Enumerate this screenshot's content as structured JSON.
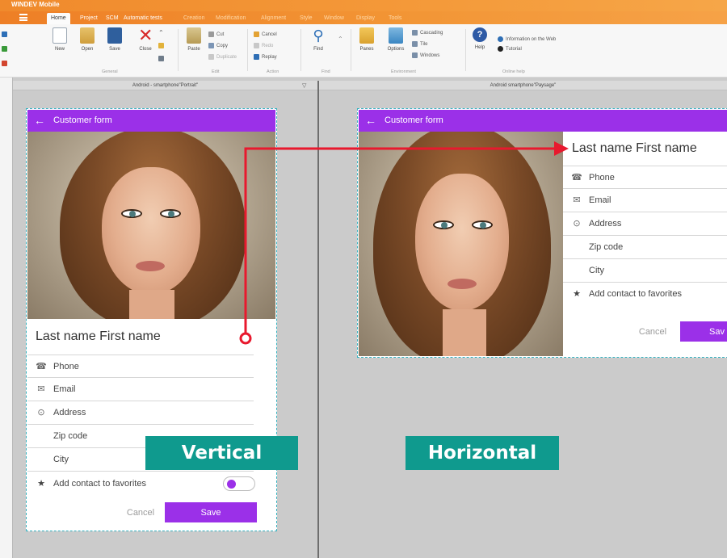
{
  "app": {
    "title": "WINDEV Mobile"
  },
  "menu_tabs": [
    {
      "label": "Home"
    },
    {
      "label": "Project"
    },
    {
      "label": "SCM"
    },
    {
      "label": "Automatic tests"
    },
    {
      "label": "Creation"
    },
    {
      "label": "Modification"
    },
    {
      "label": "Alignment"
    },
    {
      "label": "Style"
    },
    {
      "label": "Window"
    },
    {
      "label": "Display"
    },
    {
      "label": "Tools"
    }
  ],
  "ribbon": {
    "new": "New",
    "open": "Open",
    "save": "Save",
    "close": "Close",
    "paste": "Paste",
    "cut": "Cut",
    "copy": "Copy",
    "duplicate": "Duplicate",
    "cancel": "Cancel",
    "redo": "Redo",
    "replay": "Replay",
    "find": "Find",
    "panes": "Panes",
    "options": "Options",
    "cascading": "Cascading",
    "tile": "Tile",
    "windows": "Windows",
    "help": "Help",
    "info_web": "Information on the Web",
    "tutorial": "Tutorial",
    "groups": {
      "general": "General",
      "edit": "Edit",
      "action": "Action",
      "find": "Find",
      "environment": "Environment",
      "online_help": "Online help"
    }
  },
  "panes": {
    "left_header": "Android - smartphone\"Portrait\"",
    "right_header": "Android smartphone\"Paysage\""
  },
  "form": {
    "title": "Customer form",
    "back_glyph": "←",
    "name": "Last name First name",
    "phone": "Phone",
    "email": "Email",
    "address": "Address",
    "zip": "Zip code",
    "city": "City",
    "favorite": "Add contact to favorites",
    "cancel": "Cancel",
    "save": "Save",
    "save_cut": "Sav"
  },
  "icons": {
    "phone": "☎",
    "email": "✉",
    "address": "⊙",
    "star": "★"
  },
  "labels": {
    "vertical": "Vertical",
    "horizontal": "Horizontal"
  },
  "colors": {
    "accent": "#9b30e8",
    "badge": "#0f9a8e",
    "marker": "#e8192e",
    "titlebar": "#f08a2c"
  }
}
